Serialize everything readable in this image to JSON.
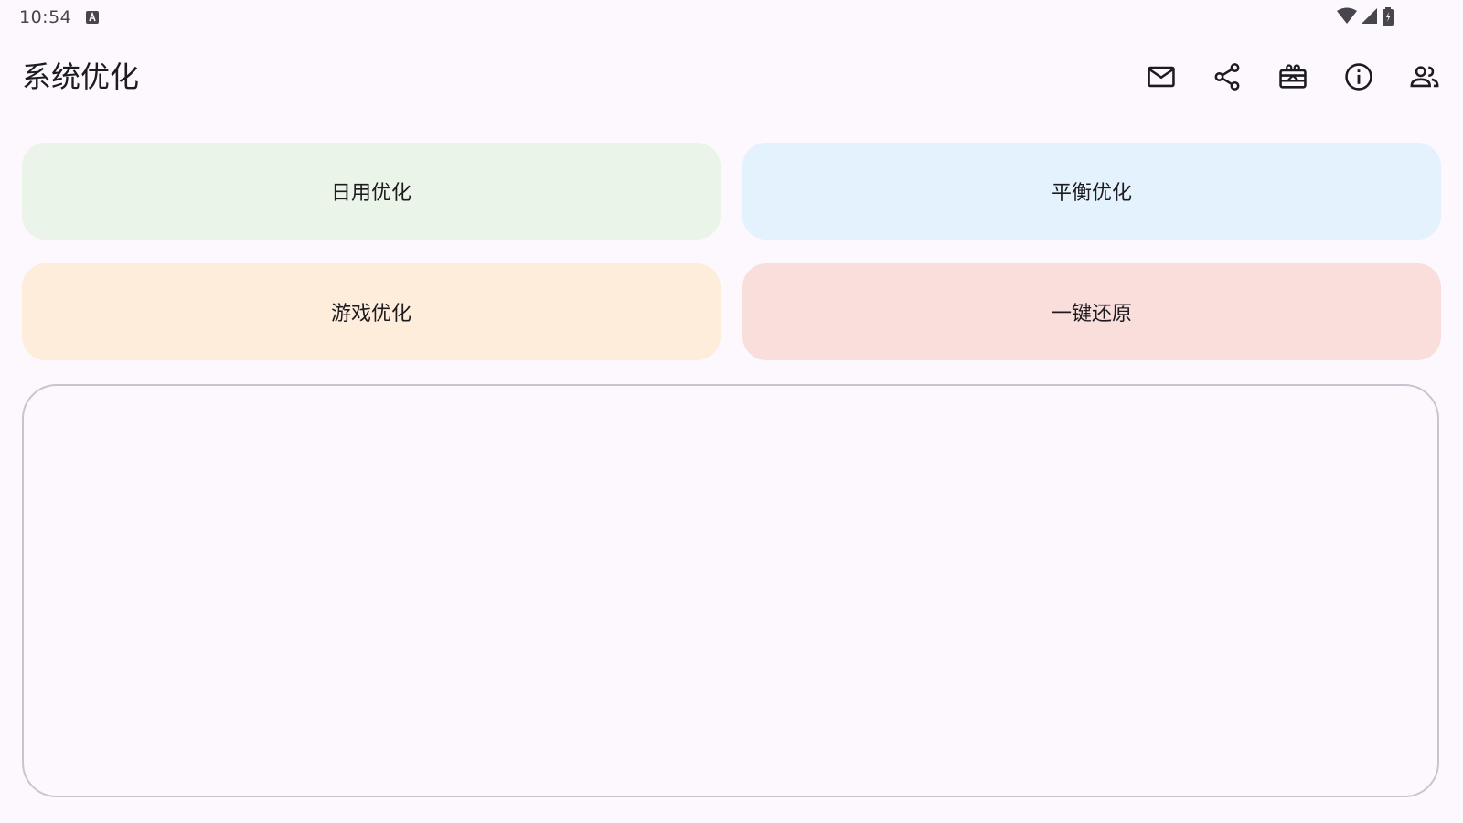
{
  "status_bar": {
    "time": "10:54",
    "icons": [
      "keyboard-a-icon",
      "wifi-icon",
      "signal-icon",
      "battery-charging-icon"
    ]
  },
  "app_bar": {
    "title": "系统优化",
    "actions": [
      "mail-icon",
      "share-icon",
      "gift-card-icon",
      "info-icon",
      "group-icon"
    ]
  },
  "buttons": {
    "daily": "日用优化",
    "balance": "平衡优化",
    "game": "游戏优化",
    "restore": "一键还原"
  },
  "output": {
    "text": ""
  },
  "colors": {
    "background": "#FDF7FE",
    "daily_bg": "#EBF4E8",
    "balance_bg": "#E3F2FC",
    "game_bg": "#FFEDDB",
    "restore_bg": "#F9DEDB",
    "panel_border": "#CAC4D0"
  }
}
